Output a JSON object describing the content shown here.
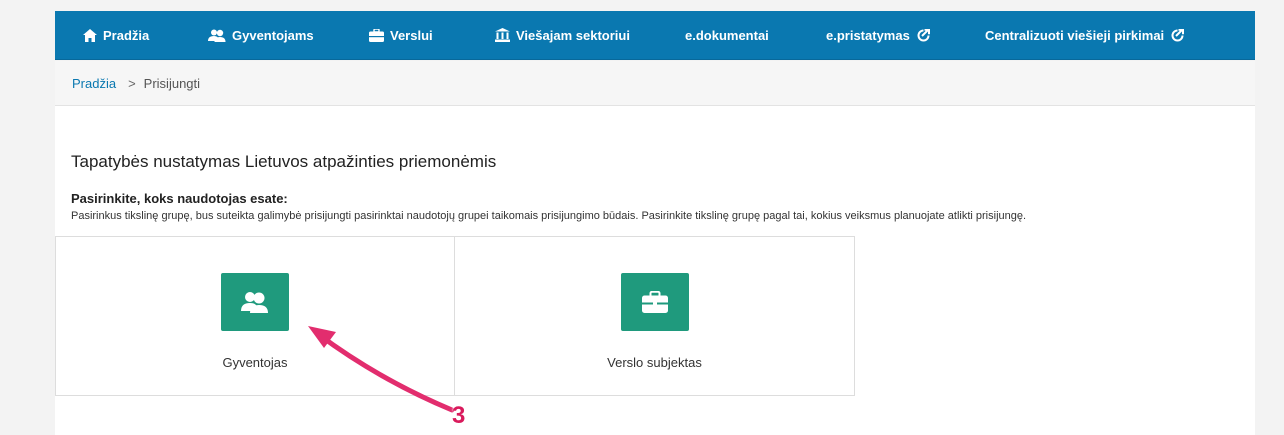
{
  "nav": {
    "items": [
      {
        "label": "Pradžia",
        "icon": "home-icon"
      },
      {
        "label": "Gyventojams",
        "icon": "users-icon"
      },
      {
        "label": "Verslui",
        "icon": "briefcase-icon"
      },
      {
        "label": "Viešajam sektoriui",
        "icon": "institution-icon"
      },
      {
        "label": "e.dokumentai",
        "icon": ""
      },
      {
        "label": "e.pristatymas",
        "icon": "external-link-icon"
      },
      {
        "label": "Centralizuoti viešieji pirkimai",
        "icon": "external-link-icon"
      }
    ],
    "background": "#0a78b0"
  },
  "breadcrumb": {
    "home": "Pradžia",
    "separator": ">",
    "current": "Prisijungti"
  },
  "main": {
    "title": "Tapatybės nustatymas Lietuvos atpažinties priemonėmis",
    "subtitle": "Pasirinkite, koks naudotojas esate:",
    "description": "Pasirinkus tikslinę grupę, bus suteikta galimybė prisijungti pasirinktai naudotojų grupei taikomais prisijungimo būdais. Pasirinkite tikslinę grupę pagal tai, kokius veiksmus planuojate atlikti prisijungę.",
    "cards": [
      {
        "label": "Gyventojas",
        "icon": "users-icon"
      },
      {
        "label": "Verslo subjektas",
        "icon": "briefcase-icon"
      }
    ],
    "accent": "#1f9a7d"
  },
  "annotation": {
    "number": "3",
    "color": "#d91a5c"
  }
}
